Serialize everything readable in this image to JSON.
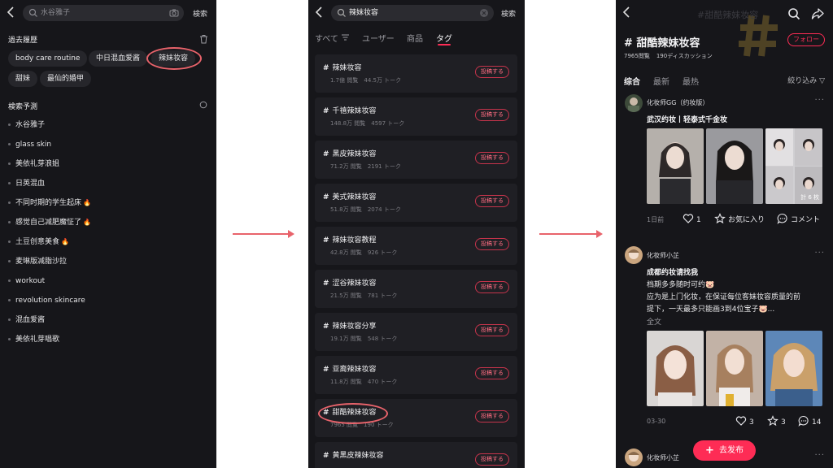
{
  "colors": {
    "accent": "#fe2c55",
    "annotation": "#e8636b",
    "screen_bg": "#16161a"
  },
  "screen1": {
    "search_placeholder": "水谷雅子",
    "search_button": "検索",
    "history_title": "過去履歴",
    "history_chips": [
      "body care routine",
      "中日混血爱酱",
      "辣妹妆容",
      "甜妹",
      "最仙的婚甲"
    ],
    "predict_title": "検索予測",
    "predictions": [
      {
        "text": "水谷雅子",
        "hot": false
      },
      {
        "text": "glass skin",
        "hot": false
      },
      {
        "text": "美依礼芽浪姐",
        "hot": false
      },
      {
        "text": "日英混血",
        "hot": false
      },
      {
        "text": "不同时期的学生起床",
        "hot": true
      },
      {
        "text": "感觉自己减肥魔怔了",
        "hot": true
      },
      {
        "text": "土豆创意美食",
        "hot": true
      },
      {
        "text": "麦琳版减脂沙拉",
        "hot": false
      },
      {
        "text": "workout",
        "hot": false
      },
      {
        "text": "revolution skincare",
        "hot": false
      },
      {
        "text": "混血爱酱",
        "hot": false
      },
      {
        "text": "美依礼芽唱歌",
        "hot": false
      }
    ],
    "hot_icon": "fire-icon"
  },
  "screen2": {
    "search_value": "辣妹妆容",
    "search_button": "検索",
    "tabs": [
      "すべて",
      "ユーザー",
      "商品",
      "タグ"
    ],
    "active_tab": "タグ",
    "post_label": "投稿する",
    "tags": [
      {
        "name": "辣妹妆容",
        "views": "1.7億 閲覧",
        "talks": "44.5万 トーク"
      },
      {
        "name": "千禧辣妹妆容",
        "views": "148.8万 閲覧",
        "talks": "4597 トーク"
      },
      {
        "name": "黑皮辣妹妆容",
        "views": "71.2万 閲覧",
        "talks": "2191 トーク"
      },
      {
        "name": "美式辣妹妆容",
        "views": "51.8万 閲覧",
        "talks": "2074 トーク"
      },
      {
        "name": "辣妹妆容教程",
        "views": "42.8万 閲覧",
        "talks": "926 トーク"
      },
      {
        "name": "涩谷辣妹妆容",
        "views": "21.5万 閲覧",
        "talks": "781 トーク"
      },
      {
        "name": "辣妹妆容分享",
        "views": "19.1万 閲覧",
        "talks": "548 トーク"
      },
      {
        "name": "亚裔辣妹妆容",
        "views": "11.8万 閲覧",
        "talks": "470 トーク"
      },
      {
        "name": "甜酷辣妹妆容",
        "views": "7965 閲覧",
        "talks": "190 トーク"
      },
      {
        "name": "黄黑皮辣妹妆容",
        "views": "",
        "talks": ""
      }
    ]
  },
  "screen3": {
    "header_ghost": "#甜酷辣妹妆容",
    "tag_title": "# 甜酷辣妹妆容",
    "follow": "フォロー",
    "views": "7965閲覧",
    "discussions": "190ディスカッション",
    "tabs": [
      "综合",
      "最新",
      "最热"
    ],
    "filter": "絞り込み",
    "posts": [
      {
        "user": "化妆师GG（约妆版）",
        "title": "武汉约妆丨轻泰式千金妆",
        "lines": [],
        "more": "",
        "image_count": "計 6 枚",
        "date": "1日前",
        "likes": "1",
        "fav_label": "お気に入り",
        "comment_label": "コメント"
      },
      {
        "user": "化妆师小芷",
        "title": "成都约妆请找我",
        "lines": [
          "档期多多随时可约🐷",
          "应为是上门化妆，在保证每位客妹妆容质量的前",
          "提下，一天最多只能画3到4位宝子🐷..."
        ],
        "more": "全文",
        "date": "03-30",
        "likes": "3",
        "favs": "3",
        "comments": "14"
      },
      {
        "user": "化妆师小芷"
      }
    ],
    "publish": "去发布"
  }
}
